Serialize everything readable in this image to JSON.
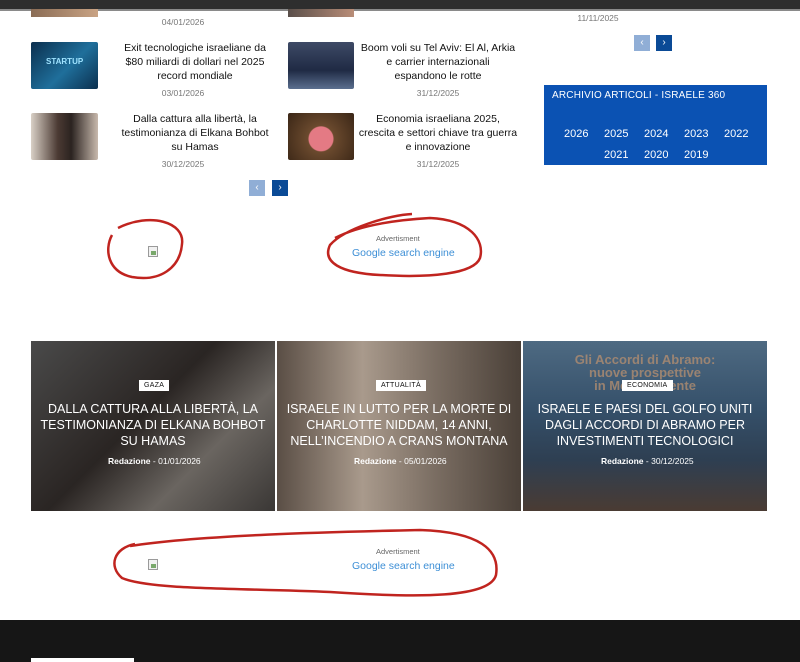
{
  "top_articles": {
    "partial_date_left": "04/01/2026",
    "partial_date_right": "11/11/2025",
    "items": [
      {
        "title_lines": [
          "Exit tecnologiche israeliane da",
          "$80 miliardi di dollari nel 2025",
          "record mondiale"
        ],
        "date": "03/01/2026"
      },
      {
        "title_lines": [
          "Boom voli su Tel Aviv: El Al, Arkia",
          "e carrier internazionali",
          "espandono le rotte"
        ],
        "date": "31/12/2025"
      },
      {
        "title_lines": [
          "Dalla cattura alla libertà, la",
          "testimonianza di Elkana Bohbot",
          "su Hamas"
        ],
        "date": "30/12/2025"
      },
      {
        "title_lines": [
          "Economia israeliana 2025,",
          "crescita e settori chiave tra guerra",
          "e innovazione"
        ],
        "date": "31/12/2025"
      }
    ],
    "thumb_icons": [
      "startup-image",
      "airplane-cabin-image",
      "hostage-reunion-image",
      "piggy-bank-image"
    ]
  },
  "pager": {
    "prev": "‹",
    "next": "›"
  },
  "archive": {
    "title": "ARCHIVIO ARTICOLI - ISRAELE 360",
    "years": [
      "2026",
      "2025",
      "2024",
      "2023",
      "2022",
      "2021",
      "2020",
      "2019"
    ]
  },
  "ads": {
    "label": "Advertisment",
    "link": "Google search engine",
    "annotation_color": "#c0241f"
  },
  "featured": [
    {
      "badge": "GAZA",
      "title_lines": [
        "DALLA CATTURA ALLA LIBERTÀ, LA",
        "TESTIMONIANZA DI ELKANA BOHBOT",
        "SU HAMAS"
      ],
      "author": "Redazione",
      "sep": "-",
      "date": "01/01/2026"
    },
    {
      "badge": "ATTUALITÀ",
      "title_lines": [
        "ISRAELE IN LUTTO PER LA MORTE DI",
        "CHARLOTTE NIDDAM, 14 ANNI,",
        "NELL’INCENDIO A CRANS MONTANA"
      ],
      "author": "Redazione",
      "sep": "-",
      "date": "05/01/2026"
    },
    {
      "badge": "ECONOMIA",
      "title_lines": [
        "ISRAELE E PAESI DEL GOLFO UNITI",
        "DAGLI ACCORDI DI ABRAMO PER",
        "INVESTIMENTI TECNOLOGICI"
      ],
      "author": "Redazione",
      "sep": "-",
      "date": "30/12/2025",
      "image_text_lines": [
        "Gli Accordi di Abramo:",
        "nuove prospettive",
        "in Medio Oriente"
      ]
    }
  ],
  "colors": {
    "accent": "#0b52b3",
    "pager_active": "#0a4a96",
    "pager_inactive": "#90aed6",
    "footer": "#161616"
  }
}
